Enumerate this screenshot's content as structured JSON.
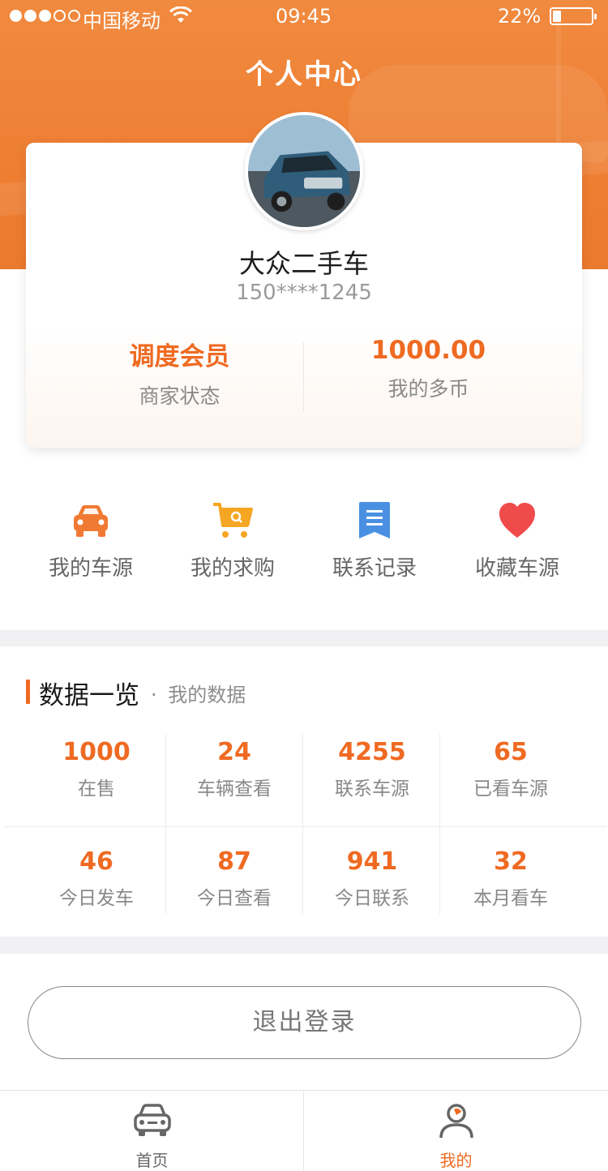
{
  "status_bar": {
    "carrier": "中国移动",
    "time": "09:45",
    "battery_percent": "22%",
    "battery_level": 0.22
  },
  "header": {
    "title": "个人中心"
  },
  "profile": {
    "name": "大众二手车",
    "phone": "150****1245",
    "stats": [
      {
        "value": "调度会员",
        "label": "商家状态"
      },
      {
        "value": "1000.00",
        "label": "我的多币"
      }
    ]
  },
  "quick_actions": [
    {
      "label": "我的车源",
      "icon": "car-icon",
      "color": "#f07a33"
    },
    {
      "label": "我的求购",
      "icon": "shopping-cart-icon",
      "color": "#f5a623"
    },
    {
      "label": "联系记录",
      "icon": "record-list-icon",
      "color": "#4a90e2"
    },
    {
      "label": "收藏车源",
      "icon": "heart-icon",
      "color": "#f04b4b"
    }
  ],
  "data_overview": {
    "title": "数据一览",
    "separator": "·",
    "subtitle": "我的数据",
    "rows": [
      [
        {
          "value": "1000",
          "label": "在售"
        },
        {
          "value": "24",
          "label": "车辆查看"
        },
        {
          "value": "4255",
          "label": "联系车源"
        },
        {
          "value": "65",
          "label": "已看车源"
        }
      ],
      [
        {
          "value": "46",
          "label": "今日发车"
        },
        {
          "value": "87",
          "label": "今日查看"
        },
        {
          "value": "941",
          "label": "今日联系"
        },
        {
          "value": "32",
          "label": "本月看车"
        }
      ]
    ]
  },
  "logout": {
    "label": "退出登录"
  },
  "tabbar": {
    "items": [
      {
        "label": "首页",
        "icon": "car-front-icon",
        "active": false
      },
      {
        "label": "我的",
        "icon": "user-icon",
        "active": true
      }
    ],
    "active_color": "#ef6a22",
    "inactive_color": "#666666"
  },
  "colors": {
    "accent": "#ef6a22",
    "header_orange": "#ee7f33"
  }
}
